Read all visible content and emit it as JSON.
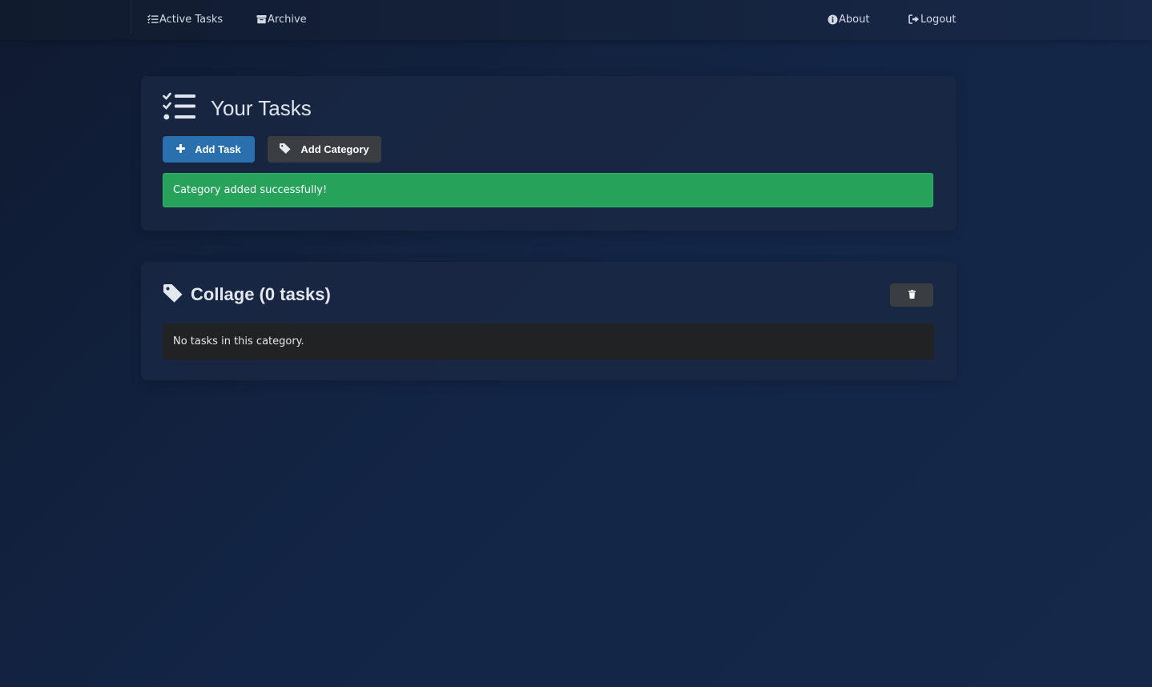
{
  "nav": {
    "active_tasks": {
      "label": "Active Tasks",
      "icon": "list-check-icon"
    },
    "archive": {
      "label": "Archive",
      "icon": "archive-box-icon"
    },
    "about": {
      "label": "About",
      "icon": "info-circle-icon"
    },
    "logout": {
      "label": "Logout",
      "icon": "sign-out-icon"
    }
  },
  "tasks_card": {
    "title": "Your Tasks",
    "title_icon": "list-check-icon",
    "add_task_label": "Add Task",
    "add_task_icon": "plus-icon",
    "add_category_label": "Add Category",
    "add_category_icon": "tag-icon",
    "alert_message": "Category added successfully!"
  },
  "category": {
    "title": "Collage (0 tasks)",
    "icon": "tag-icon",
    "delete_icon": "trash-icon",
    "empty_message": "No tasks in this category."
  },
  "colors": {
    "background": "#132546",
    "primary_button": "#2a6fae",
    "secondary_button": "#3a3d42",
    "success_alert": "#27a25a",
    "empty_box": "#212223"
  }
}
